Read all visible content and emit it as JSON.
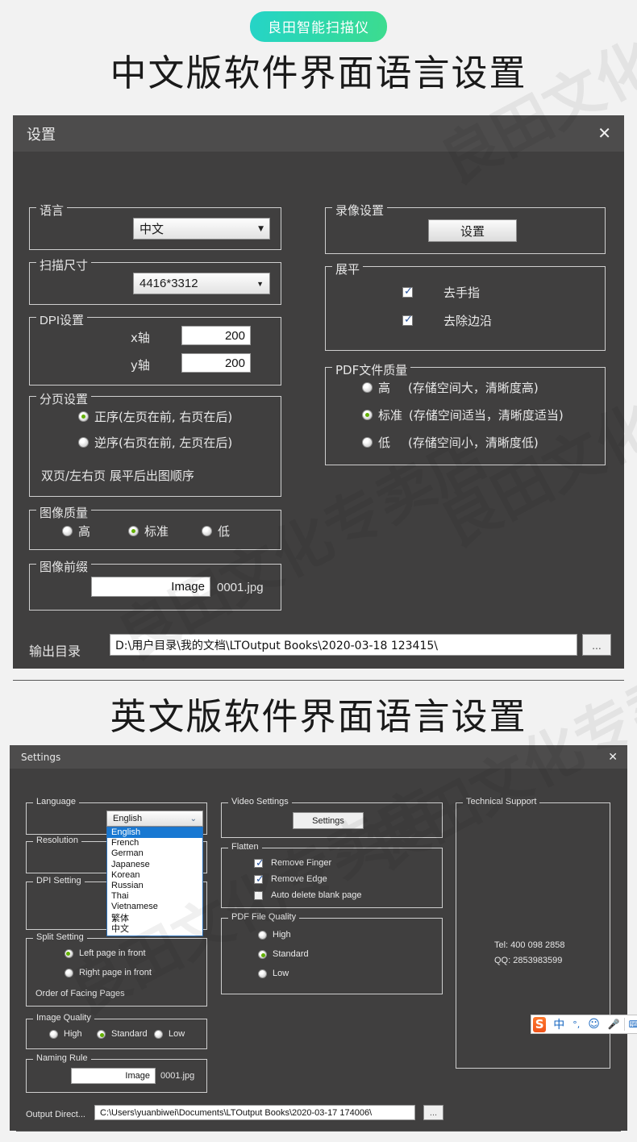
{
  "header": {
    "badge": "良田智能扫描仪",
    "zh_section_title": "中文版软件界面语言设置",
    "en_section_title": "英文版软件界面语言设置",
    "badge_color_from": "#25d4c8",
    "badge_color_to": "#3ddc8e",
    "watermark_text": "良田文化专卖店"
  },
  "zh_dialog": {
    "title": "设置",
    "close_icon": "close-icon",
    "language": {
      "legend": "语言",
      "selected": "中文",
      "arrow_icon": "chevron-down-icon"
    },
    "scan_size": {
      "legend": "扫描尺寸",
      "selected": "4416*3312",
      "arrow_icon": "chevron-down-icon"
    },
    "dpi": {
      "legend": "DPI设置",
      "x_label": "x轴",
      "x_value": "200",
      "y_label": "y轴",
      "y_value": "200"
    },
    "split": {
      "legend": "分页设置",
      "options": [
        {
          "label": "正序(左页在前, 右页在后)",
          "selected": true
        },
        {
          "label": "逆序(右页在前, 左页在后)",
          "selected": false
        }
      ],
      "note": "双页/左右页 展平后出图顺序"
    },
    "image_quality": {
      "legend": "图像质量",
      "options": [
        {
          "label": "高",
          "selected": false
        },
        {
          "label": "标准",
          "selected": true
        },
        {
          "label": "低",
          "selected": false
        }
      ]
    },
    "naming": {
      "legend": "图像前缀",
      "value": "Image",
      "suffix": "0001.jpg"
    },
    "video": {
      "legend": "录像设置",
      "button": "设置"
    },
    "flatten": {
      "legend": "展平",
      "options": [
        {
          "label": "去手指",
          "checked": true
        },
        {
          "label": "去除边沿",
          "checked": true
        }
      ]
    },
    "pdf_quality": {
      "legend": "PDF文件质量",
      "options": [
        {
          "label": "高",
          "note": "(存储空间大，清晰度高)",
          "selected": false
        },
        {
          "label": "标准",
          "note": "(存储空间适当，清晰度适当)",
          "selected": true
        },
        {
          "label": "低",
          "note": "(存储空间小，清晰度低)",
          "selected": false
        }
      ]
    },
    "output": {
      "label": "输出目录",
      "value": "D:\\用户目录\\我的文档\\LTOutput Books\\2020-03-18 123415\\",
      "browse": "..."
    }
  },
  "en_dialog": {
    "title": "Settings",
    "close_icon": "close-icon",
    "language": {
      "legend": "Language",
      "selected": "English",
      "arrow_icon": "chevron-down-icon",
      "options": [
        "English",
        "French",
        "German",
        "Japanese",
        "Korean",
        "Russian",
        "Thai",
        "Vietnamese",
        "繁体",
        "中文"
      ],
      "highlighted": "English"
    },
    "resolution": {
      "legend": "Resolution"
    },
    "dpi": {
      "legend": "DPI Setting"
    },
    "split": {
      "legend": "Split Setting",
      "options": [
        {
          "label": "Left page in front",
          "selected": true
        },
        {
          "label": "Right page in front",
          "selected": false
        }
      ],
      "note": "Order of Facing Pages"
    },
    "image_quality": {
      "legend": "Image Quality",
      "options": [
        {
          "label": "High",
          "selected": false
        },
        {
          "label": "Standard",
          "selected": true
        },
        {
          "label": "Low",
          "selected": false
        }
      ]
    },
    "naming": {
      "legend": "Naming Rule",
      "value": "Image",
      "suffix": "0001.jpg"
    },
    "video": {
      "legend": "Video Settings",
      "button": "Settings"
    },
    "flatten": {
      "legend": "Flatten",
      "options": [
        {
          "label": "Remove Finger",
          "checked": true
        },
        {
          "label": "Remove Edge",
          "checked": true
        },
        {
          "label": "Auto delete blank page",
          "checked": false
        }
      ]
    },
    "pdf_quality": {
      "legend": "PDF File Quality",
      "options": [
        {
          "label": "High",
          "selected": false
        },
        {
          "label": "Standard",
          "selected": true
        },
        {
          "label": "Low",
          "selected": false
        }
      ]
    },
    "support": {
      "legend": "Technical Support",
      "tel": "Tel: 400 098 2858",
      "qq": "QQ: 2853983599"
    },
    "output": {
      "label": "Output Direct...",
      "value": "C:\\Users\\yuanbiwei\\Documents\\LTOutput Books\\2020-03-17 174006\\",
      "browse": "..."
    },
    "ime": {
      "logo": "S",
      "mode": "中",
      "punct": "°,",
      "emoji": "☺",
      "mic": "🎤",
      "keyboard": "⌨"
    }
  }
}
